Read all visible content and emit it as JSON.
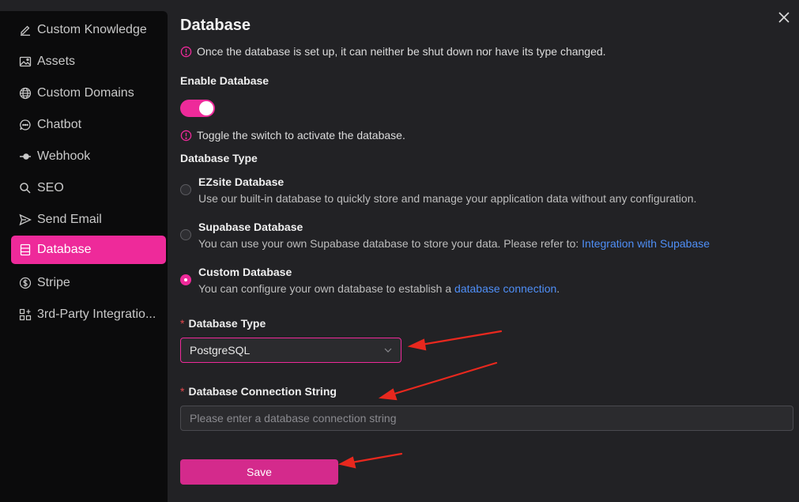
{
  "sidebar": {
    "items": [
      {
        "label": "Custom Knowledge",
        "icon": "edit-icon"
      },
      {
        "label": "Assets",
        "icon": "image-icon"
      },
      {
        "label": "Custom Domains",
        "icon": "globe-icon"
      },
      {
        "label": "Chatbot",
        "icon": "chat-bubble-icon"
      },
      {
        "label": "Webhook",
        "icon": "webhook-icon"
      },
      {
        "label": "SEO",
        "icon": "search-icon"
      },
      {
        "label": "Send Email",
        "icon": "send-icon"
      },
      {
        "label": "Database",
        "icon": "database-icon",
        "active": true
      },
      {
        "label": "Stripe",
        "icon": "dollar-icon"
      },
      {
        "label": "3rd-Party Integratio...",
        "icon": "integration-icon"
      }
    ]
  },
  "main": {
    "title": "Database",
    "warning": "Once the database is set up, it can neither be shut down nor have its type changed.",
    "enable_label": "Enable Database",
    "enable_on": true,
    "enable_hint": "Toggle the switch to activate the database.",
    "type_label": "Database Type",
    "options": [
      {
        "title": "EZsite Database",
        "desc": "Use our built-in database to quickly store and manage your application data without any configuration.",
        "selected": false
      },
      {
        "title": "Supabase Database",
        "desc": "You can use your own Supabase database to store your data. Please refer to: ",
        "link": "Integration with Supabase",
        "selected": false
      },
      {
        "title": "Custom Database",
        "desc": "You can configure your own database to establish a ",
        "link": "database connection",
        "suffix": ".",
        "selected": true
      }
    ],
    "db_type_field": {
      "required_mark": "*",
      "label": "Database Type",
      "value": "PostgreSQL"
    },
    "conn_field": {
      "required_mark": "*",
      "label": "Database Connection String",
      "placeholder": "Please enter a database connection string"
    },
    "save_label": "Save"
  },
  "colors": {
    "accent": "#ee2a9a",
    "link": "#4f8ff7",
    "annotation_arrow": "#e8281e"
  }
}
